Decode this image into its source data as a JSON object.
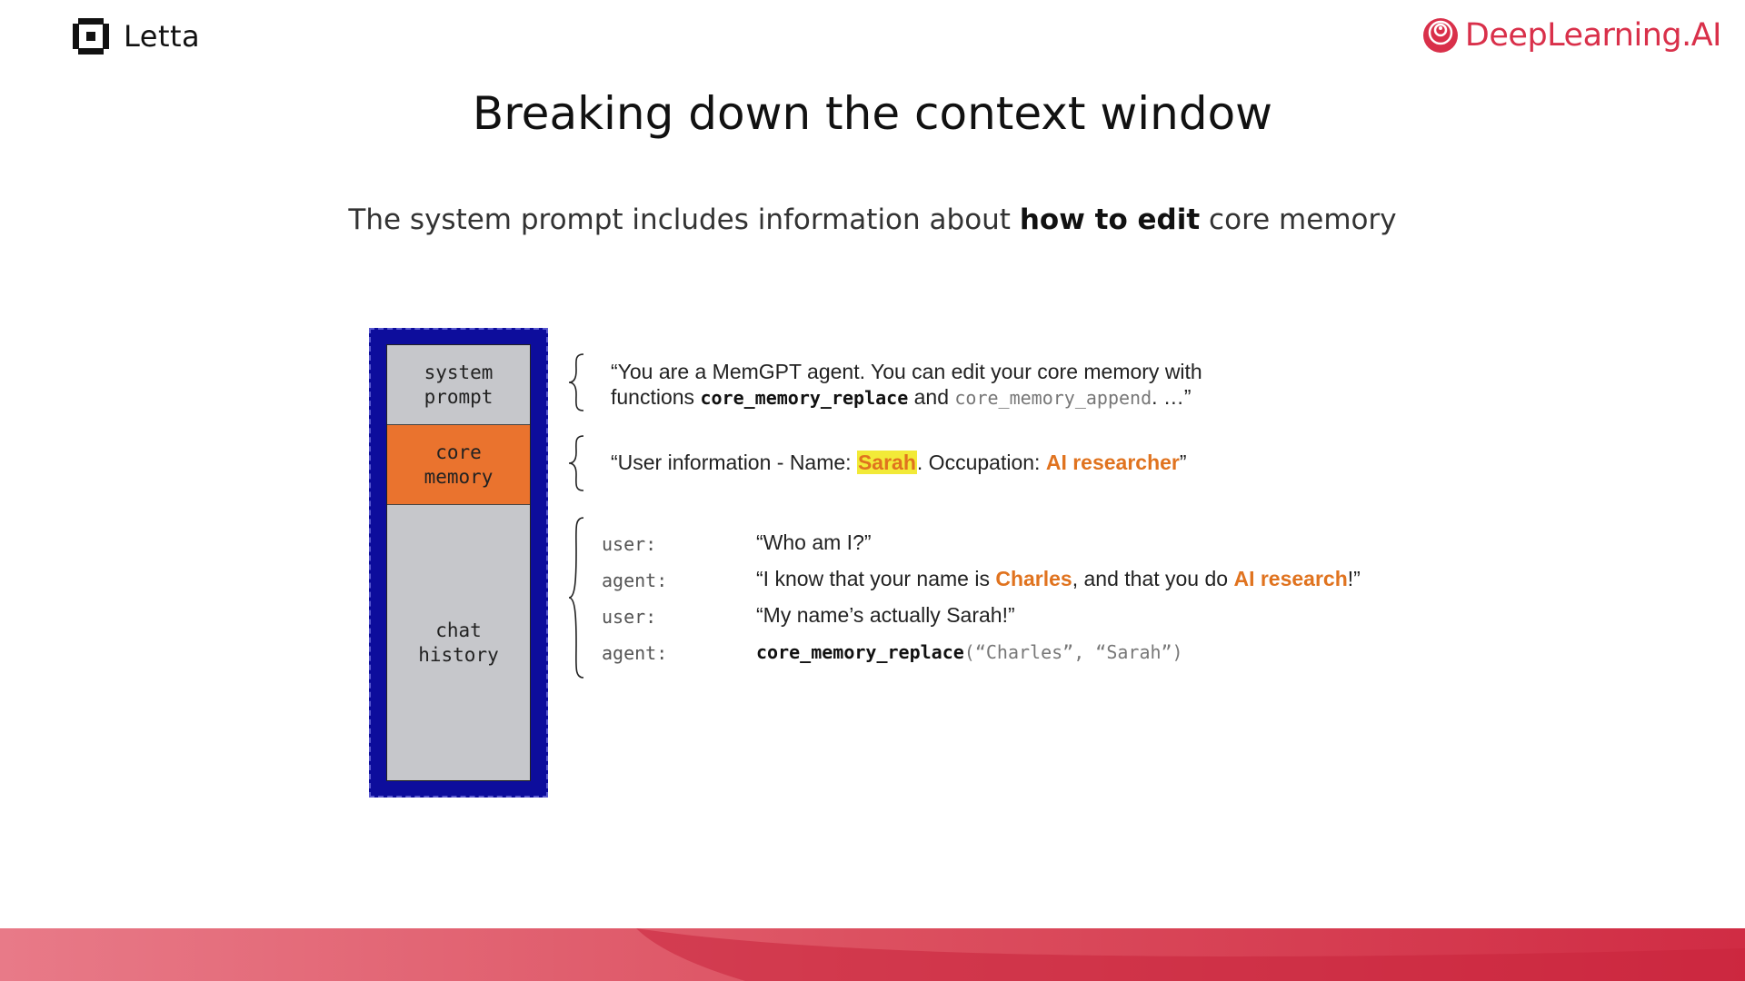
{
  "header": {
    "left_logo_text": "Letta",
    "right_logo_text": "DeepLearning.AI"
  },
  "title": "Breaking down the context window",
  "subtitle": {
    "before": "The system prompt includes information about ",
    "bold": "how to edit",
    "after": " core memory"
  },
  "context_window": {
    "segments": [
      {
        "label": "system\nprompt"
      },
      {
        "label": "core\nmemory"
      },
      {
        "label": "chat\nhistory"
      }
    ]
  },
  "system_prompt": {
    "line1": "“You are a MemGPT agent. You can edit your core memory with",
    "line2_prefix": "functions ",
    "fn_replace": "core_memory_replace",
    "line2_mid": " and ",
    "fn_append": "core_memory_append",
    "line2_suffix": ". …”"
  },
  "core_memory": {
    "prefix": "“User information - Name: ",
    "name": "Sarah",
    "mid": ". Occupation: ",
    "occupation": "AI researcher",
    "suffix": "”"
  },
  "chat": [
    {
      "speaker": "user:",
      "text": "“Who am I?”"
    },
    {
      "speaker": "agent:",
      "prefix": "“I know that your name is ",
      "name": "Charles",
      "mid": ", and that you do ",
      "topic": "AI research",
      "suffix": "!”"
    },
    {
      "speaker": "user:",
      "text": "“My name’s actually Sarah!”"
    },
    {
      "speaker": "agent:",
      "fn": "core_memory_replace",
      "args": "(“Charles”, “Sarah”)"
    }
  ],
  "colors": {
    "brand_red": "#d9304a",
    "context_border": "#0d0d9c",
    "core_memory_orange": "#ea732e",
    "highlight_yellow": "#f2ea38",
    "accent_orange_text": "#e0731f"
  }
}
